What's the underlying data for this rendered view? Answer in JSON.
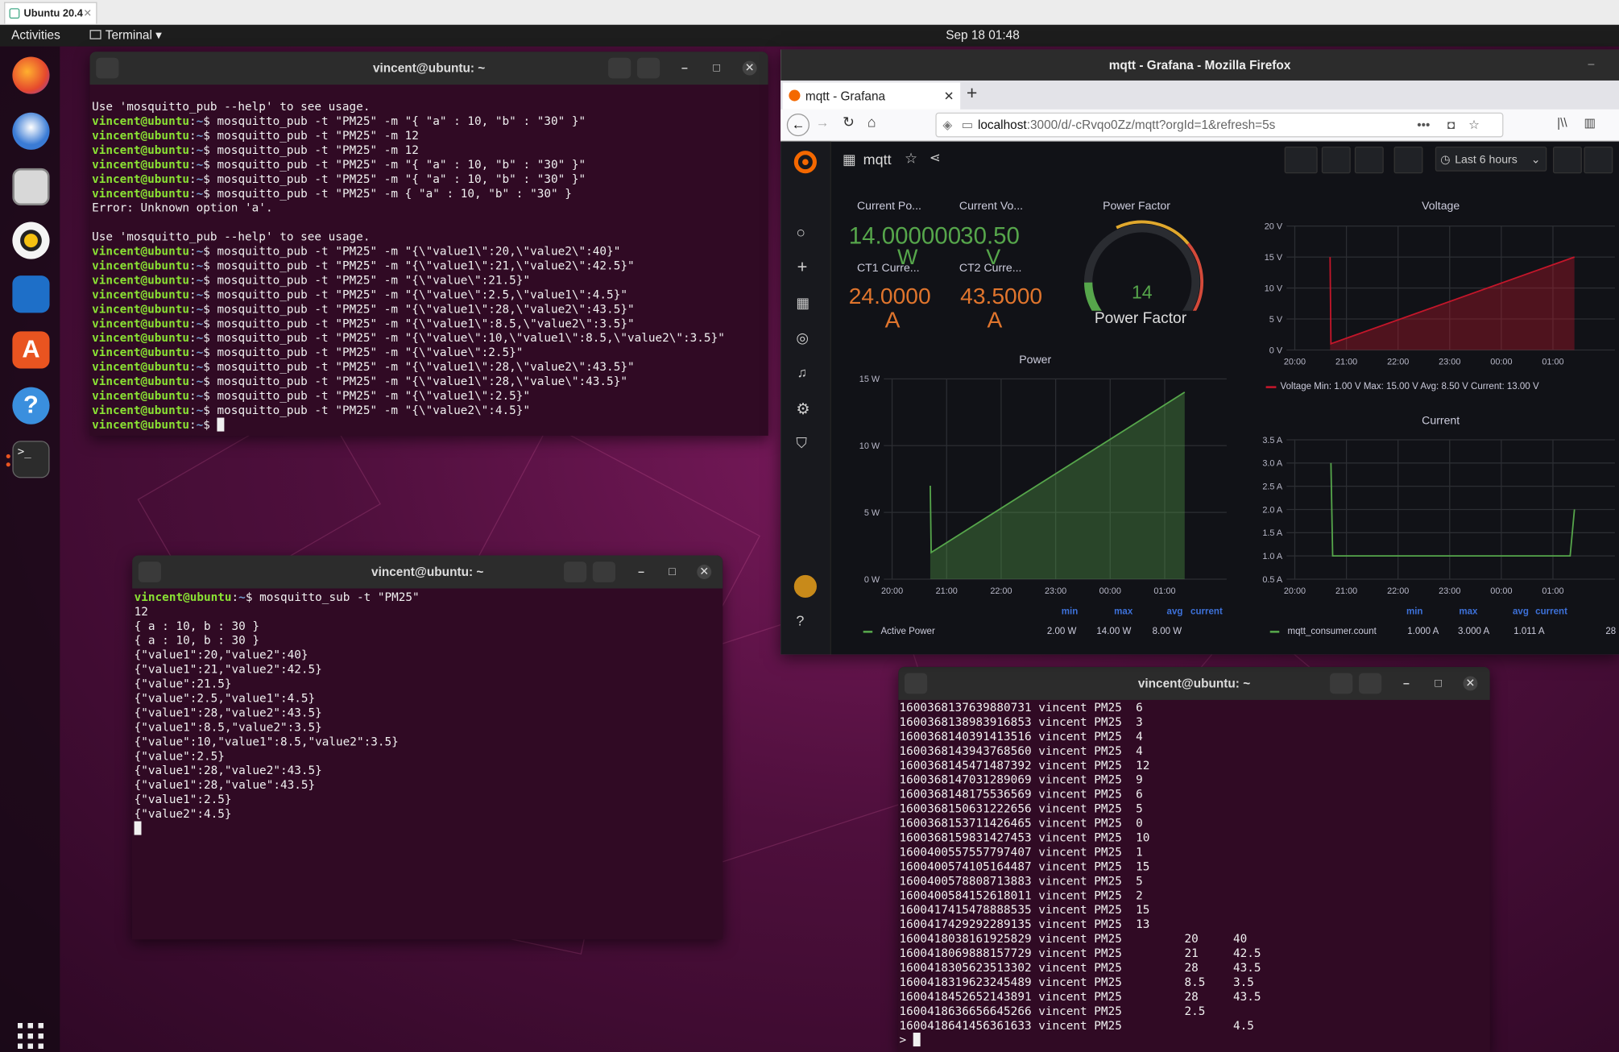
{
  "vm": {
    "tab_title": "Ubuntu 20.4"
  },
  "topbar": {
    "activities": "Activities",
    "app_menu": "Terminal ▾",
    "clock": "Sep 18  01:48"
  },
  "terminal1": {
    "title": "vincent@ubuntu: ~",
    "output": "Use 'mosquitto_pub --help' to see usage.\n{P} mosquitto_pub -t \"PM25\" -m \"{ \"a\" : 10, \"b\" : \"30\" }\"\n{P} mosquitto_pub -t \"PM25\" -m 12\n{P} mosquitto_pub -t \"PM25\" -m 12\n{P} mosquitto_pub -t \"PM25\" -m \"{ \"a\" : 10, \"b\" : \"30\" }\"\n{P} mosquitto_pub -t \"PM25\" -m \"{ \"a\" : 10, \"b\" : \"30\" }\"\n{P} mosquitto_pub -t \"PM25\" -m { \"a\" : 10, \"b\" : \"30\" }\nError: Unknown option 'a'.\n\nUse 'mosquitto_pub --help' to see usage.\n{P} mosquitto_pub -t \"PM25\" -m \"{\\\"value1\\\":20,\\\"value2\\\":40}\"\n{P} mosquitto_pub -t \"PM25\" -m \"{\\\"value1\\\":21,\\\"value2\\\":42.5}\"\n{P} mosquitto_pub -t \"PM25\" -m \"{\\\"value\\\":21.5}\"\n{P} mosquitto_pub -t \"PM25\" -m \"{\\\"value\\\":2.5,\\\"value1\\\":4.5}\"\n{P} mosquitto_pub -t \"PM25\" -m \"{\\\"value1\\\":28,\\\"value2\\\":43.5}\"\n{P} mosquitto_pub -t \"PM25\" -m \"{\\\"value1\\\":8.5,\\\"value2\\\":3.5}\"\n{P} mosquitto_pub -t \"PM25\" -m \"{\\\"value\\\":10,\\\"value1\\\":8.5,\\\"value2\\\":3.5}\"\n{P} mosquitto_pub -t \"PM25\" -m \"{\\\"value\\\":2.5}\"\n{P} mosquitto_pub -t \"PM25\" -m \"{\\\"value1\\\":28,\\\"value2\\\":43.5}\"\n{P} mosquitto_pub -t \"PM25\" -m \"{\\\"value1\\\":28,\\\"value\\\":43.5}\"\n{P} mosquitto_pub -t \"PM25\" -m \"{\\\"value1\\\":2.5}\"\n{P} mosquitto_pub -t \"PM25\" -m \"{\\\"value2\\\":4.5}\"\n{P} █",
    "prompt": "vincent@ubuntu:~$"
  },
  "terminal2": {
    "title": "vincent@ubuntu: ~",
    "output": "{P} mosquitto_sub -t \"PM25\"\n12\n{ a : 10, b : 30 }\n{ a : 10, b : 30 }\n{\"value1\":20,\"value2\":40}\n{\"value1\":21,\"value2\":42.5}\n{\"value\":21.5}\n{\"value\":2.5,\"value1\":4.5}\n{\"value1\":28,\"value2\":43.5}\n{\"value1\":8.5,\"value2\":3.5}\n{\"value\":10,\"value1\":8.5,\"value2\":3.5}\n{\"value\":2.5}\n{\"value1\":28,\"value2\":43.5}\n{\"value1\":28,\"value\":43.5}\n{\"value1\":2.5}\n{\"value2\":4.5}\n█",
    "prompt": "vincent@ubuntu:~$"
  },
  "terminal3": {
    "title": "vincent@ubuntu: ~",
    "output": "1600368137639880731 vincent PM25  6\n1600368138983916853 vincent PM25  3\n1600368140391413516 vincent PM25  4\n1600368143943768560 vincent PM25  4\n1600368145471487392 vincent PM25  12\n1600368147031289069 vincent PM25  9\n1600368148175536569 vincent PM25  6\n1600368150631222656 vincent PM25  5\n1600368153711426465 vincent PM25  0\n1600368159831427453 vincent PM25  10\n1600400557557797407 vincent PM25  1\n1600400574105164487 vincent PM25  15\n1600400578808713883 vincent PM25  5\n1600400584152618011 vincent PM25  2\n1600417415478888535 vincent PM25  15\n1600417429292289135 vincent PM25  13\n1600418038161925829 vincent PM25         20     40\n1600418069888157729 vincent PM25         21     42.5\n1600418305623513302 vincent PM25         28     43.5\n1600418319623245489 vincent PM25         8.5    3.5\n1600418452652143891 vincent PM25         28     43.5\n1600418636656645266 vincent PM25         2.5\n1600418641456361633 vincent PM25                4.5\n> █"
  },
  "firefox": {
    "window_title": "mqtt - Grafana - Mozilla Firefox",
    "tab_title": "mqtt - Grafana",
    "url_host": "localhost",
    "url_rest": ":3000/d/-cRvqo0Zz/mqtt?orgId=1&refresh=5s"
  },
  "grafana": {
    "dashboard_title": "mqtt",
    "time_range": "Last 6 hours",
    "stats": [
      {
        "label": "Current Po...",
        "value": "14.000000",
        "unit": "W",
        "color": "#56a64b"
      },
      {
        "label": "Current Vo...",
        "value": "30.50",
        "unit": "V",
        "color": "#56a64b"
      },
      {
        "label": "CT1 Curre...",
        "value": "24.0000",
        "unit": "A",
        "color": "#e0752d"
      },
      {
        "label": "CT2 Curre...",
        "value": "43.5000",
        "unit": "A",
        "color": "#e0752d"
      }
    ],
    "gauge": {
      "title": "Power Factor",
      "value": "14",
      "label": "Power Factor",
      "fraction": 0.14
    },
    "voltage_panel": {
      "title": "Voltage",
      "legend": "Voltage  Min: 1.00 V  Max: 15.00 V  Avg: 8.50 V  Current: 13.00 V"
    },
    "power_panel": {
      "title": "Power",
      "legend_headers": [
        "min",
        "max",
        "avg",
        "current"
      ],
      "legend_series": "Active Power",
      "legend_values": [
        "2.00 W",
        "14.00 W",
        "8.00 W"
      ]
    },
    "current_panel": {
      "title": "Current",
      "legend_headers": [
        "min",
        "max",
        "avg",
        "current"
      ],
      "legend_series": "mqtt_consumer.count",
      "legend_values": [
        "1.000 A",
        "3.000 A",
        "1.011 A",
        "28"
      ]
    }
  },
  "chart_data": [
    {
      "type": "area",
      "title": "Voltage",
      "x_ticks": [
        "20:00",
        "21:00",
        "22:00",
        "23:00",
        "00:00",
        "01:00"
      ],
      "y_ticks": [
        "0 V",
        "5 V",
        "10 V",
        "15 V",
        "20 V"
      ],
      "ylim": [
        0,
        20
      ],
      "color": "#c4162a",
      "series": [
        {
          "name": "Voltage",
          "points": [
            [
              "20:41",
              15
            ],
            [
              "20:42",
              1
            ],
            [
              "01:25",
              15
            ]
          ]
        }
      ]
    },
    {
      "type": "area",
      "title": "Power",
      "x_ticks": [
        "20:00",
        "21:00",
        "22:00",
        "23:00",
        "00:00",
        "01:00"
      ],
      "y_ticks": [
        "0 W",
        "5 W",
        "10 W",
        "15 W"
      ],
      "ylim": [
        0,
        15
      ],
      "color": "#56a64b",
      "series": [
        {
          "name": "Active Power",
          "points": [
            [
              "20:42",
              7
            ],
            [
              "20:43",
              2
            ],
            [
              "01:22",
              14
            ]
          ]
        }
      ]
    },
    {
      "type": "line",
      "title": "Current",
      "x_ticks": [
        "20:00",
        "21:00",
        "22:00",
        "23:00",
        "00:00",
        "01:00"
      ],
      "y_ticks": [
        "0.5 A",
        "1.0 A",
        "1.5 A",
        "2.0 A",
        "2.5 A",
        "3.0 A",
        "3.5 A"
      ],
      "ylim": [
        0.5,
        3.5
      ],
      "color": "#56a64b",
      "series": [
        {
          "name": "mqtt_consumer.count",
          "points": [
            [
              "20:42",
              3
            ],
            [
              "20:44",
              1
            ],
            [
              "01:20",
              1
            ],
            [
              "01:25",
              2
            ]
          ]
        }
      ]
    }
  ]
}
